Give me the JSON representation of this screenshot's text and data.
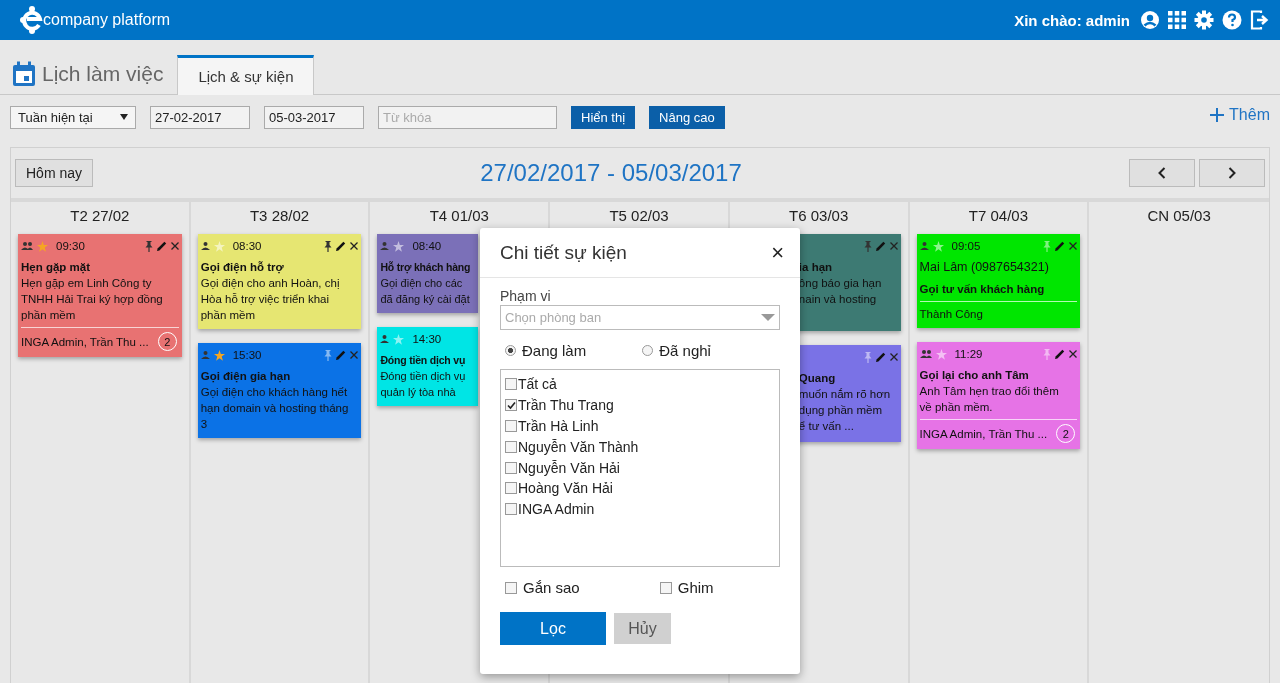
{
  "header": {
    "brand": "company platform",
    "greeting": "Xin chào: admin"
  },
  "page_title": "Lịch làm việc",
  "tabs": [
    {
      "label": "Lịch & sự kiện",
      "selected": true
    }
  ],
  "toolbar": {
    "range": "Tuần hiện tại",
    "from": "27-02-2017",
    "to": "05-03-2017",
    "keyword_placeholder": "Từ khóa",
    "show_button": "Hiển thị",
    "advanced_button": "Nâng cao",
    "add_button": "Thêm"
  },
  "calendar": {
    "today_button": "Hôm nay",
    "title": "27/02/2017 - 05/03/2017",
    "days": [
      {
        "label": "T2 27/02",
        "events": [
          {
            "color": "#e87272",
            "shared": true,
            "starred": true,
            "time": "09:30",
            "pinned": true,
            "title": "Hẹn gặp mặt",
            "body": [
              "Hẹn gặp em Linh Công ty",
              "TNHH Hải Trai ký hợp đồng",
              "phần mềm"
            ],
            "footer": "INGA Admin, Trần Thu ...",
            "count": "2"
          }
        ]
      },
      {
        "label": "T3 28/02",
        "events": [
          {
            "color": "#e6e672",
            "shared": false,
            "starred": false,
            "time": "08:30",
            "pinned": true,
            "title": "Gọi điện hỗ trợ",
            "body": [
              "Gọi điện cho anh Hoàn, chị",
              "Hòa hỗ trợ việc triển khai",
              "phần mềm"
            ]
          },
          {
            "color": "#0b72e6",
            "shared": false,
            "starred": true,
            "time": "15:30",
            "pinned": false,
            "title": "Gọi điện gia hạn",
            "body": [
              "Gọi điện cho khách hàng hết",
              "hạn domain và hosting tháng",
              "3"
            ]
          }
        ]
      },
      {
        "label": "T4 01/03",
        "events": [
          {
            "color": "#7b70b8",
            "shared": false,
            "starred": false,
            "time": "08:40",
            "title": "Hỗ trợ khách hàng",
            "body": [
              "Gọi điện cho các",
              "đã đăng ký cài đặt"
            ]
          },
          {
            "color": "#00e5e5",
            "shared": false,
            "starred": false,
            "time": "14:30",
            "title": "Đóng tiền dịch vụ",
            "body": [
              "Đóng tiền dịch vụ",
              "quản lý tòa nhà"
            ]
          }
        ]
      },
      {
        "label": "T5 02/03"
      },
      {
        "label": "T6 03/03",
        "events": [
          {
            "color": "#3d7a73",
            "pinned": true,
            "title": "ia hạn",
            "body": [
              "ông báo gia hạn",
              "nain và hosting"
            ]
          },
          {
            "color": "#7a72e6",
            "pinned": false,
            "title": "Quang",
            "body": [
              "muốn nắm rõ hơn",
              "dụng phần mềm",
              "ể tư vấn ..."
            ]
          }
        ]
      },
      {
        "label": "T7 04/03",
        "events": [
          {
            "color": "#00e600",
            "shared": false,
            "starred": false,
            "time": "09:05",
            "pinned": false,
            "contact": "Mai Lâm (0987654321)",
            "title": "Gọi tư vấn khách hàng",
            "footer": "Thành Công"
          },
          {
            "color": "#e673e6",
            "shared": true,
            "starred": false,
            "time": "11:29",
            "pinned": false,
            "title": "Gọi lại cho anh Tâm",
            "body": [
              "Anh Tâm hẹn trao đổi thêm",
              "về phần mềm."
            ],
            "footer": "INGA Admin, Trần Thu ...",
            "count": "2"
          }
        ]
      },
      {
        "label": "CN 05/03"
      }
    ]
  },
  "dialog": {
    "title": "Chi tiết sự kiện",
    "close": "×",
    "scope_label": "Phạm vi",
    "scope_placeholder": "Chọn phòng ban",
    "status": [
      {
        "label": "Đang làm",
        "selected": true
      },
      {
        "label": "Đã nghỉ",
        "selected": false
      }
    ],
    "people": [
      {
        "label": "Tất cả",
        "checked": false
      },
      {
        "label": "Trần Thu Trang",
        "checked": true
      },
      {
        "label": "Trần Hà Linh",
        "checked": false
      },
      {
        "label": "Nguyễn Văn Thành",
        "checked": false
      },
      {
        "label": "Nguyễn Văn Hải",
        "checked": false
      },
      {
        "label": "Hoàng Văn Hải",
        "checked": false
      },
      {
        "label": "INGA Admin",
        "checked": false
      }
    ],
    "flags": [
      {
        "label": "Gắn sao",
        "checked": false
      },
      {
        "label": "Ghim",
        "checked": false
      }
    ],
    "filter_button": "Lọc",
    "cancel_button": "Hủy"
  }
}
